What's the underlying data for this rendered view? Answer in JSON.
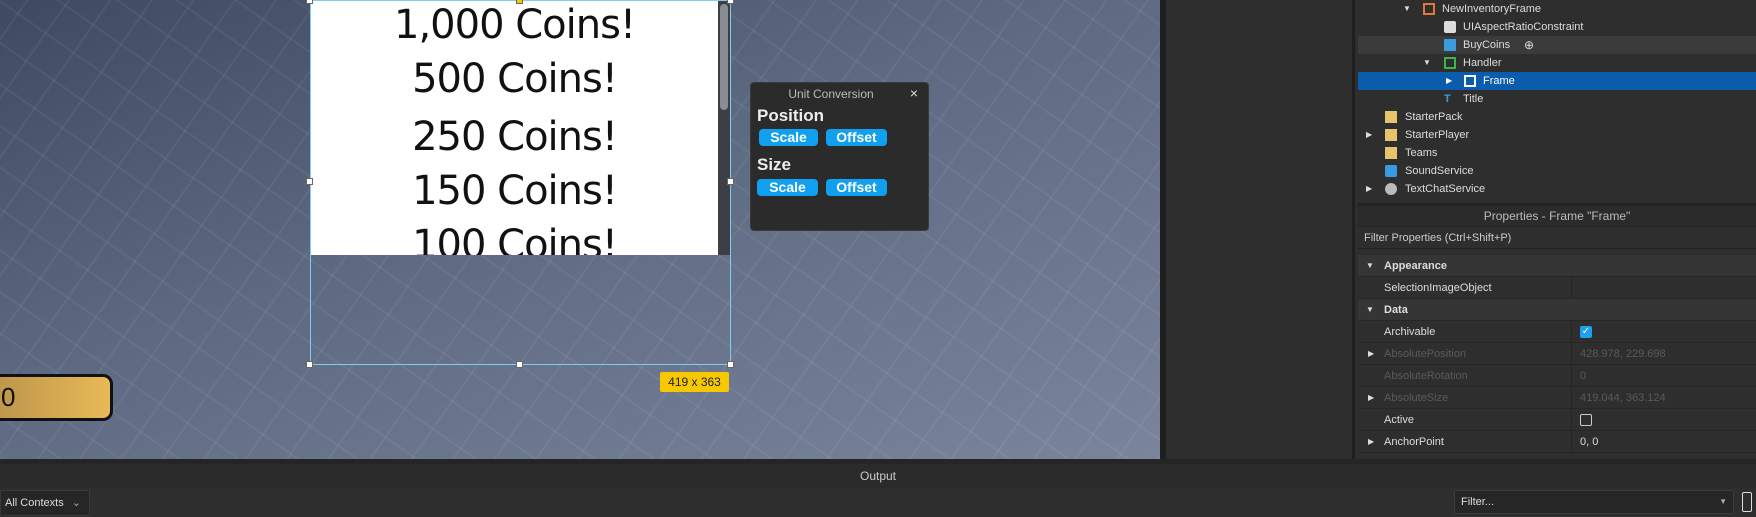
{
  "viewport": {
    "coins": [
      "1,000 Coins!",
      "500 Coins!",
      "250 Coins!",
      "150 Coins!",
      "100 Coins!"
    ],
    "size_label": "419 x 363",
    "gold_button_text": "0"
  },
  "unit_conversion": {
    "title": "Unit Conversion",
    "close": "×",
    "position_label": "Position",
    "size_label": "Size",
    "scale": "Scale",
    "offset": "Offset"
  },
  "explorer": {
    "items": [
      {
        "label": "NewInventoryFrame",
        "expanded": true
      },
      {
        "label": "UIAspectRatioConstraint"
      },
      {
        "label": "BuyCoins",
        "add": "⊕"
      },
      {
        "label": "Handler",
        "expanded": true
      },
      {
        "label": "Frame",
        "selected": true
      },
      {
        "label": "Title"
      },
      {
        "label": "StarterPack"
      },
      {
        "label": "StarterPlayer"
      },
      {
        "label": "Teams"
      },
      {
        "label": "SoundService"
      },
      {
        "label": "TextChatService"
      }
    ]
  },
  "properties": {
    "title": "Properties - Frame \"Frame\"",
    "filter_placeholder": "Filter Properties (Ctrl+Shift+P)",
    "rows": [
      {
        "name": "Appearance"
      },
      {
        "name": "SelectionImageObject",
        "value": ""
      },
      {
        "name": "Data"
      },
      {
        "name": "Archivable",
        "checked": true
      },
      {
        "name": "AbsolutePosition",
        "value": "428.978, 229.698"
      },
      {
        "name": "AbsoluteRotation",
        "value": "0"
      },
      {
        "name": "AbsoluteSize",
        "value": "419.044, 363.124"
      },
      {
        "name": "Active",
        "checked": false
      },
      {
        "name": "AnchorPoint",
        "value": "0, 0"
      }
    ]
  },
  "output": {
    "title": "Output",
    "context": "All Contexts",
    "filter_placeholder": "Filter..."
  },
  "colors": {
    "accent": "#11a0f0",
    "selection": "#0b5cad",
    "size_badge": "#f7c700"
  }
}
